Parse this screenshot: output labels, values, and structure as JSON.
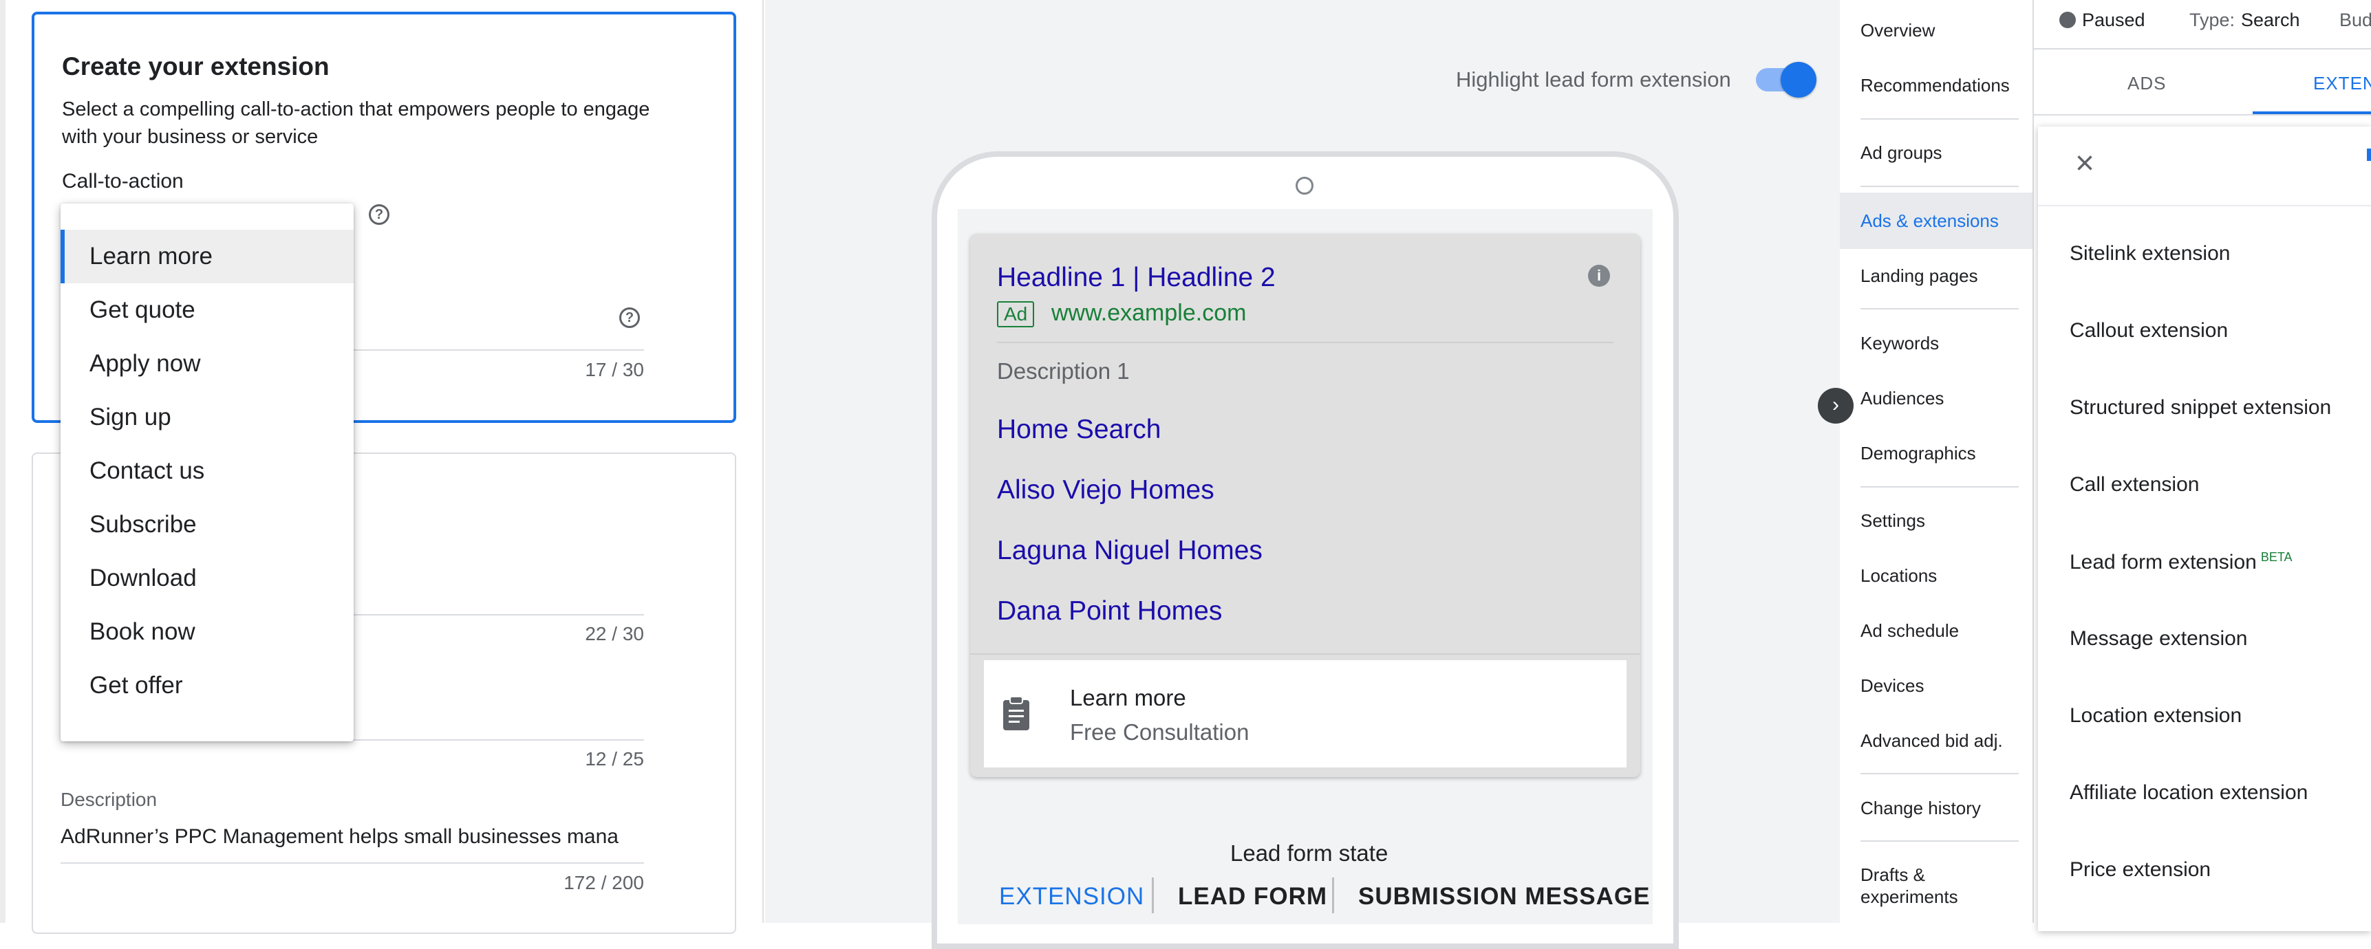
{
  "form": {
    "card_title": "Create your extension",
    "card_subtitle": "Select a compelling call-to-action that empowers people to engage with your business or service",
    "cta_label": "Call-to-action",
    "counter_1": "17 / 30",
    "counter_2": "22 / 30",
    "counter_3": "12 / 25",
    "description_label": "Description",
    "description_value": "AdRunner’s PPC Management helps small businesses mana",
    "description_counter": "172 / 200"
  },
  "cta_menu": {
    "items": [
      "Learn more",
      "Get quote",
      "Apply now",
      "Sign up",
      "Contact us",
      "Subscribe",
      "Download",
      "Book now",
      "Get offer"
    ],
    "selected": "Learn more"
  },
  "preview": {
    "highlight_label": "Highlight lead form extension",
    "highlight_on": true,
    "ad": {
      "headline": "Headline 1 | Headline 2",
      "badge": "Ad",
      "url": "www.example.com",
      "description": "Description 1",
      "sitelinks": [
        "Home Search",
        "Aliso Viejo Homes",
        "Laguna Niguel Homes",
        "Dana Point Homes"
      ]
    },
    "lead_form": {
      "title": "Learn more",
      "subtitle": "Free Consultation"
    },
    "state_label": "Lead form state",
    "state_tabs": [
      "EXTENSION",
      "LEAD FORM",
      "SUBMISSION MESSAGE"
    ],
    "active_state": "EXTENSION"
  },
  "nav": {
    "items": [
      "Overview",
      "Recommendations",
      "Ad groups",
      "Ads & extensions",
      "Landing pages",
      "Keywords",
      "Audiences",
      "Demographics",
      "Settings",
      "Locations",
      "Ad schedule",
      "Devices",
      "Advanced bid adj.",
      "Change history",
      "Drafts & experiments"
    ],
    "active": "Ads & extensions"
  },
  "right": {
    "status": "Paused",
    "type_label": "Type:",
    "type_value": "Search",
    "budget_label": "Budg",
    "tabs": [
      "ADS",
      "EXTENS"
    ],
    "active_tab": "EXTENS",
    "extensions": [
      "Sitelink extension",
      "Callout extension",
      "Structured snippet extension",
      "Call extension",
      "Lead form extension",
      "Message extension",
      "Location extension",
      "Affiliate location extension",
      "Price extension"
    ],
    "beta_label": "BETA"
  },
  "colors": {
    "accent": "#1a73e8",
    "link": "#1a0dab",
    "url_green": "#188038"
  }
}
